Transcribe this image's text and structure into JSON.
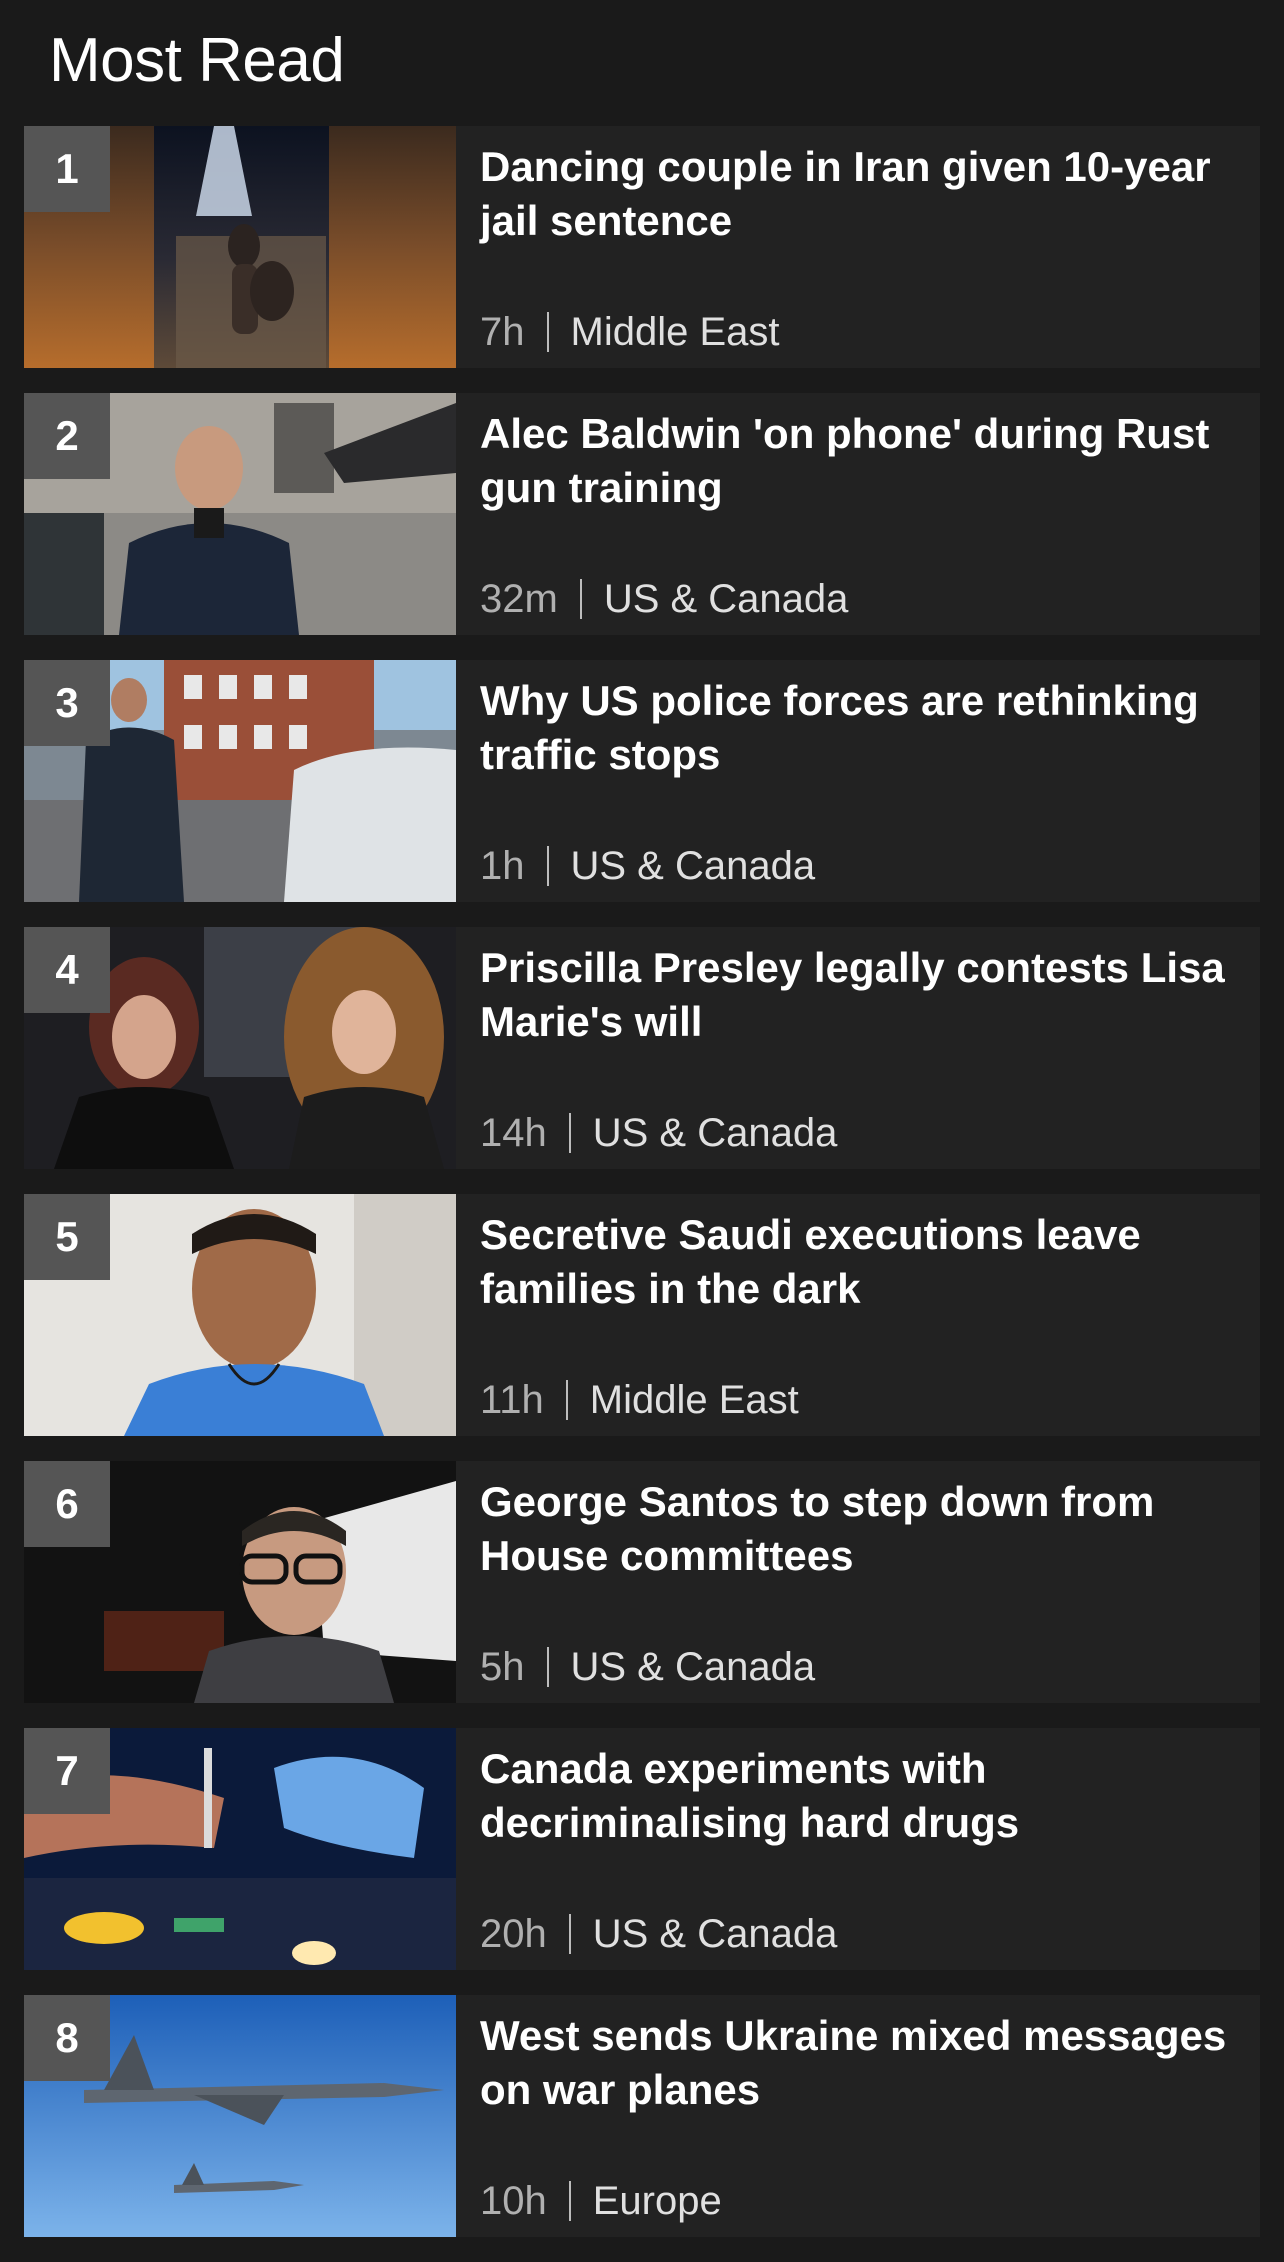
{
  "header": {
    "title": "Most Read"
  },
  "colors": {
    "background": "#1a1a1a",
    "card": "#222222",
    "rank_badge": "#555555",
    "headline": "#ffffff",
    "meta_time": "#b0b0b0",
    "meta_section": "#e0e0e0"
  },
  "items": [
    {
      "rank": "1",
      "headline": "Dancing couple in Iran given 10-year jail sentence",
      "time": "7h",
      "section": "Middle East",
      "thumbnail": "dancing-couple-photo"
    },
    {
      "rank": "2",
      "headline": "Alec Baldwin 'on phone' during Rust gun training",
      "time": "32m",
      "section": "US & Canada",
      "thumbnail": "alec-baldwin-photo"
    },
    {
      "rank": "3",
      "headline": "Why US police forces are rethinking traffic stops",
      "time": "1h",
      "section": "US & Canada",
      "thumbnail": "police-officer-photo"
    },
    {
      "rank": "4",
      "headline": "Priscilla Presley legally contests Lisa Marie's will",
      "time": "14h",
      "section": "US & Canada",
      "thumbnail": "presley-photo"
    },
    {
      "rank": "5",
      "headline": "Secretive Saudi executions leave families in the dark",
      "time": "11h",
      "section": "Middle East",
      "thumbnail": "man-portrait-photo"
    },
    {
      "rank": "6",
      "headline": "George Santos to step down from House committees",
      "time": "5h",
      "section": "US & Canada",
      "thumbnail": "george-santos-photo"
    },
    {
      "rank": "7",
      "headline": "Canada experiments with decriminalising hard drugs",
      "time": "20h",
      "section": "US & Canada",
      "thumbnail": "syringe-photo"
    },
    {
      "rank": "8",
      "headline": "West sends Ukraine mixed messages on war planes",
      "time": "10h",
      "section": "Europe",
      "thumbnail": "fighter-jets-photo"
    }
  ]
}
